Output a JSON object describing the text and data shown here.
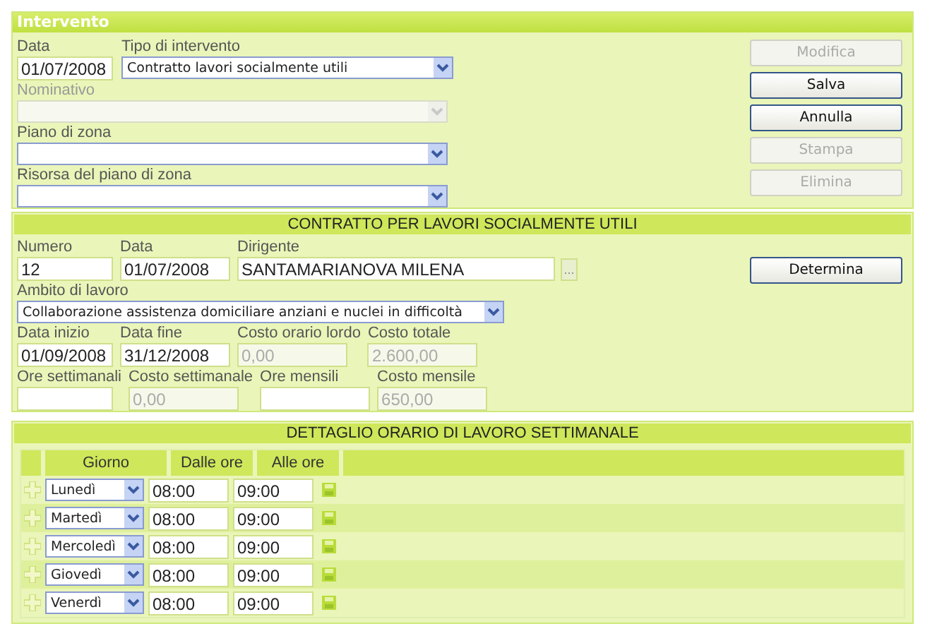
{
  "intervento": {
    "title": "Intervento",
    "fields": [
      {
        "label": "Data",
        "value": "01/07/2008",
        "kind": "text",
        "disabled": false
      },
      {
        "label": "Tipo di intervento",
        "value": "Contratto lavori socialmente utili",
        "kind": "select",
        "disabled": false
      },
      {
        "label": "Nominativo",
        "kind": "select",
        "disabled": true
      },
      {
        "label": "Piano di zona",
        "kind": "select",
        "disabled": false
      },
      {
        "label": "Risorsa del piano di zona",
        "kind": "select",
        "disabled": false
      }
    ],
    "buttons": [
      {
        "label": "Modifica",
        "disabled": true
      },
      {
        "label": "Salva",
        "disabled": false
      },
      {
        "label": "Annulla",
        "disabled": false
      },
      {
        "label": "Stampa",
        "disabled": true
      },
      {
        "label": "Elimina",
        "disabled": true
      }
    ]
  },
  "contratto": {
    "title": "CONTRATTO PER LAVORI SOCIALMENTE UTILI",
    "rows": [
      {
        "fields": [
          {
            "label": "Numero",
            "value": "12",
            "kind": "text",
            "disabled": false
          },
          {
            "label": "Data",
            "value": "01/07/2008",
            "kind": "text",
            "disabled": false
          },
          {
            "label": "Dirigente",
            "value": "SANTAMARIANOVA MILENA",
            "kind": "text",
            "disabled": false,
            "button": "..."
          }
        ]
      },
      {
        "fields": [
          {
            "label": "Ambito di lavoro",
            "value": "Collaborazione assistenza domiciliare anziani e nuclei in difficoltà",
            "kind": "select",
            "disabled": false
          }
        ]
      },
      {
        "fields": [
          {
            "label": "Data inizio",
            "value": "01/09/2008",
            "kind": "text",
            "disabled": false
          },
          {
            "label": "Data fine",
            "value": "31/12/2008",
            "kind": "text",
            "disabled": false
          },
          {
            "label": "Costo orario lordo",
            "value": "0,00",
            "kind": "text",
            "disabled": true
          },
          {
            "label": "Costo totale",
            "value": "2.600,00",
            "kind": "text",
            "disabled": true
          }
        ]
      },
      {
        "fields": [
          {
            "label": "Ore settimanali",
            "kind": "text",
            "disabled": false
          },
          {
            "label": "Costo settimanale",
            "value": "0,00",
            "kind": "text",
            "disabled": true
          },
          {
            "label": "Ore mensili",
            "kind": "text",
            "disabled": false
          },
          {
            "label": "Costo mensile",
            "value": "650,00",
            "kind": "text",
            "disabled": true
          }
        ]
      }
    ],
    "buttons": [
      {
        "label": "Determina",
        "disabled": false
      }
    ]
  },
  "dettaglio": {
    "title": "DETTAGLIO ORARIO DI LAVORO SETTIMANALE",
    "columns": [
      "Giorno",
      "Dalle ore",
      "Alle ore"
    ],
    "rows": [
      {
        "day": "Lunedì",
        "from": "08:00",
        "to": "09:00"
      },
      {
        "day": "Martedì",
        "from": "08:00",
        "to": "09:00"
      },
      {
        "day": "Mercoledì",
        "from": "08:00",
        "to": "09:00"
      },
      {
        "day": "Giovedì",
        "from": "08:00",
        "to": "09:00"
      },
      {
        "day": "Venerdì",
        "from": "08:00",
        "to": "09:00"
      }
    ]
  }
}
